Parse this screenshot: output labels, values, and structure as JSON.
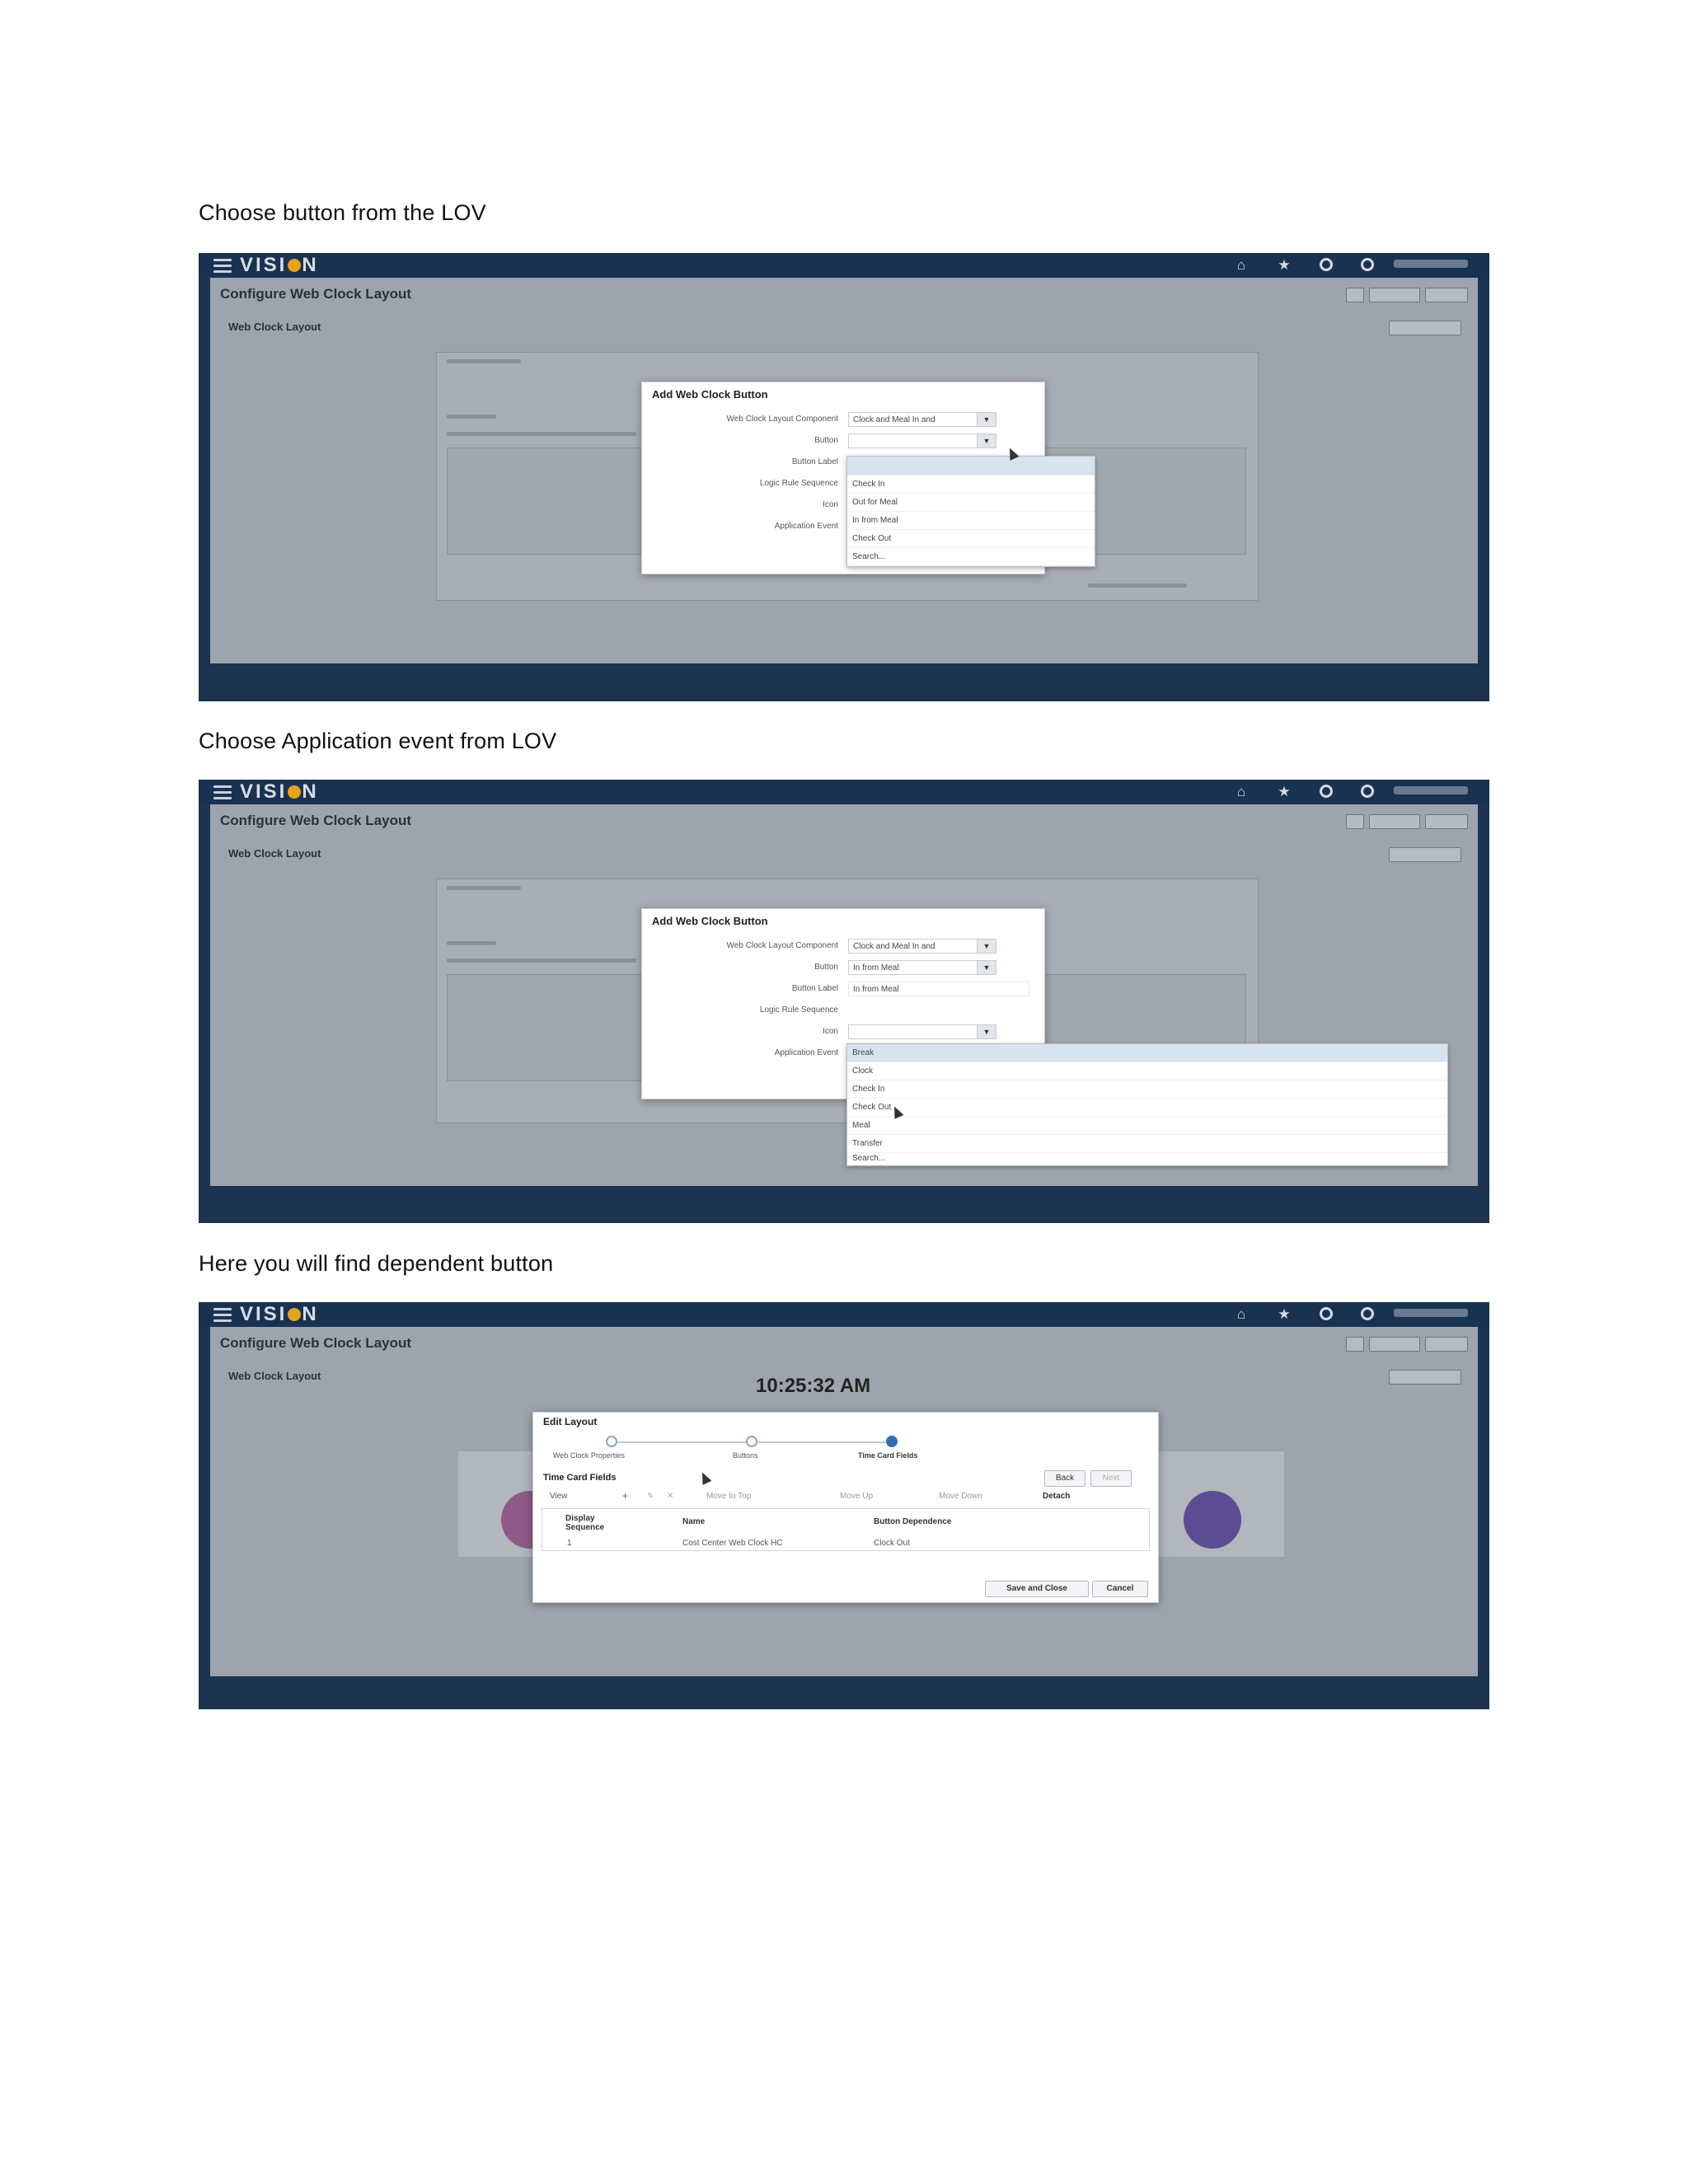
{
  "captions": [
    "Choose button from the LOV",
    "Choose Application event from LOV",
    "Here you will find dependent button"
  ],
  "app": {
    "brand": "VISION",
    "page_title": "Configure Web Clock Layout",
    "section_title": "Web Clock Layout"
  },
  "modal_add": {
    "title": "Add Web Clock Button",
    "labels": [
      "Web Clock Layout Component",
      "Button",
      "Button Label",
      "Logic Rule Sequence",
      "Icon",
      "Application Event"
    ],
    "component_value": "Clock and Meal In and",
    "button_value_2": "In from Meal",
    "button_label_value_2": "In from Meal"
  },
  "lov_button": {
    "items": [
      "Check In",
      "Out for Meal",
      "In from Meal",
      "Check Out",
      "Search..."
    ]
  },
  "lov_event": {
    "items": [
      "Break",
      "Clock",
      "Check In",
      "Check Out",
      "Meal",
      "Transfer",
      "Search..."
    ]
  },
  "modal_edit": {
    "title": "Edit Layout",
    "time": "10:25:32 AM",
    "steps": [
      "Web Clock Properties",
      "Buttons",
      "Time Card Fields"
    ],
    "section": "Time Card Fields",
    "toolbar": [
      "View",
      "Move to Top",
      "Move Up",
      "Move Down",
      "Detach"
    ],
    "nav": [
      "Back",
      "Next"
    ],
    "columns": [
      "Display Sequence",
      "Name",
      "Button Dependence"
    ],
    "row": [
      "1",
      "Cost Center Web Clock HC",
      "Clock Out"
    ],
    "save_close": "Save and Close",
    "cancel": "Cancel"
  },
  "colors": {
    "topbar": "#1a3252",
    "accent": "#e8a317",
    "train_current": "#2f6fb6"
  }
}
